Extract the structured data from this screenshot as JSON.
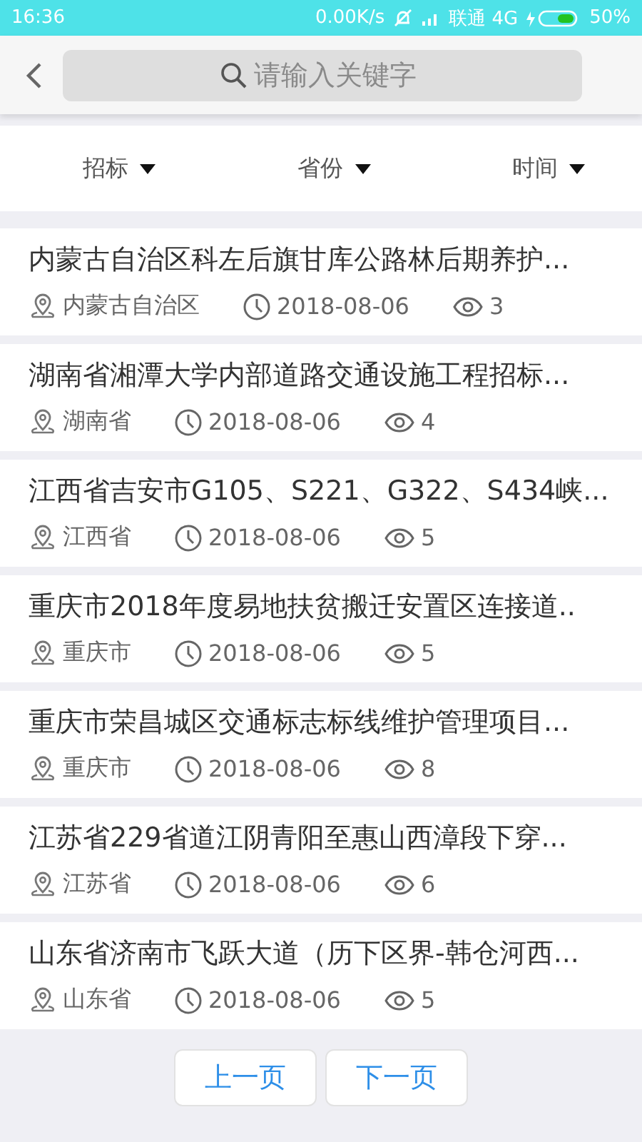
{
  "status_bar": {
    "time": "16:36",
    "speed": "0.00K/s",
    "carrier": "联通 4G",
    "battery": "50%"
  },
  "search": {
    "placeholder": "请输入关键字"
  },
  "filters": [
    {
      "label": "招标"
    },
    {
      "label": "省份"
    },
    {
      "label": "时间"
    }
  ],
  "items": [
    {
      "title": "内蒙古自治区科左后旗甘库公路林后期养护...",
      "region": "内蒙古自治区",
      "date": "2018-08-06",
      "views": "3"
    },
    {
      "title": "湖南省湘潭大学内部道路交通设施工程招标...",
      "region": "湖南省",
      "date": "2018-08-06",
      "views": "4"
    },
    {
      "title": "江西省吉安市G105、S221、G322、S434峡...",
      "region": "江西省",
      "date": "2018-08-06",
      "views": "5"
    },
    {
      "title": "重庆市2018年度易地扶贫搬迁安置区连接道..",
      "region": "重庆市",
      "date": "2018-08-06",
      "views": "5"
    },
    {
      "title": "重庆市荣昌城区交通标志标线维护管理项目...",
      "region": "重庆市",
      "date": "2018-08-06",
      "views": "8"
    },
    {
      "title": "江苏省229省道江阴青阳至惠山西漳段下穿...",
      "region": "江苏省",
      "date": "2018-08-06",
      "views": "6"
    },
    {
      "title": "山东省济南市飞跃大道（历下区界-韩仓河西...",
      "region": "山东省",
      "date": "2018-08-06",
      "views": "5"
    }
  ],
  "pager": {
    "prev": "上一页",
    "next": "下一页"
  }
}
